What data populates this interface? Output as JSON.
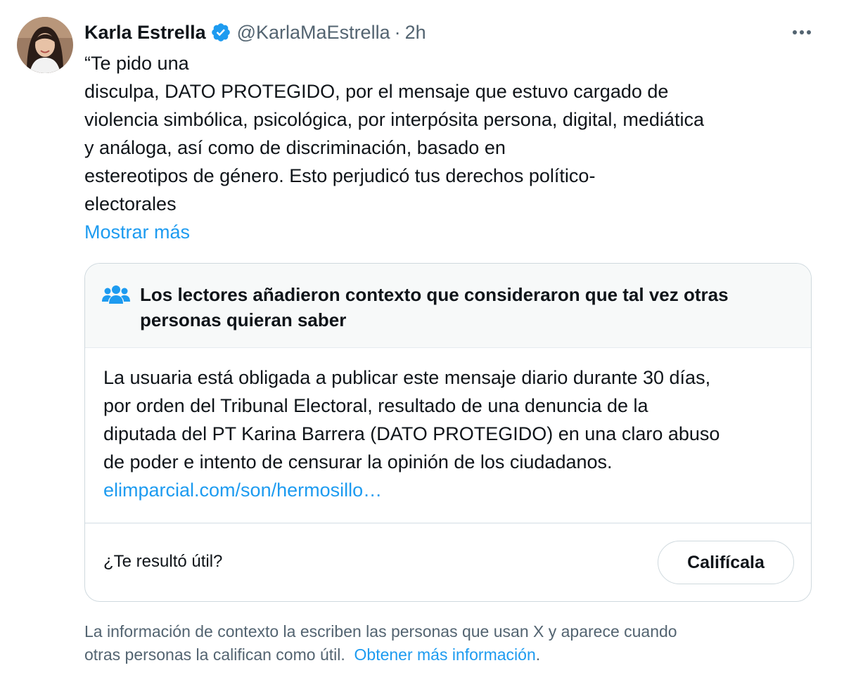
{
  "tweet": {
    "author": {
      "display_name": "Karla Estrella",
      "handle": "@KarlaMaEstrella",
      "verified": true
    },
    "separator": "·",
    "time": "2h",
    "text_lines": [
      "“Te pido una",
      "disculpa, DATO PROTEGIDO, por el mensaje que estuvo cargado de",
      "violencia simbólica, psicológica, por interpósita persona, digital, mediática",
      "y análoga, así como de discriminación, basado en",
      "estereotipos de género. Esto perjudicó tus derechos político-",
      "electorales"
    ],
    "show_more": "Mostrar más"
  },
  "community_note": {
    "title_lines": [
      "Los lectores añadieron contexto que consideraron que tal vez otras",
      "personas quieran saber"
    ],
    "body_lines": [
      "La usuaria está obligada a publicar este mensaje diario durante 30 días,",
      "por orden del Tribunal Electoral, resultado de una denuncia de la",
      "diputada del PT Karina Barrera (DATO PROTEGIDO) en una claro abuso",
      "de poder e intento de censurar la opinión de los ciudadanos."
    ],
    "link_text": "elimparcial.com/son/hermosillo…",
    "helpful_question": "¿Te resultó útil?",
    "rate_button": "Califícala"
  },
  "footer": {
    "line1": "La información de contexto la escriben las personas que usan X y aparece cuando",
    "line2": "otras personas la califican como útil.",
    "link": "Obtener más información",
    "period": "."
  },
  "colors": {
    "accent": "#1d9bf0",
    "text": "#0f1419",
    "secondary": "#536471",
    "border": "#cfd9de",
    "note_header_bg": "#f7f9f9"
  },
  "icons": {
    "verified": "verified-badge-icon",
    "more": "more-options-icon",
    "community": "community-people-icon"
  }
}
